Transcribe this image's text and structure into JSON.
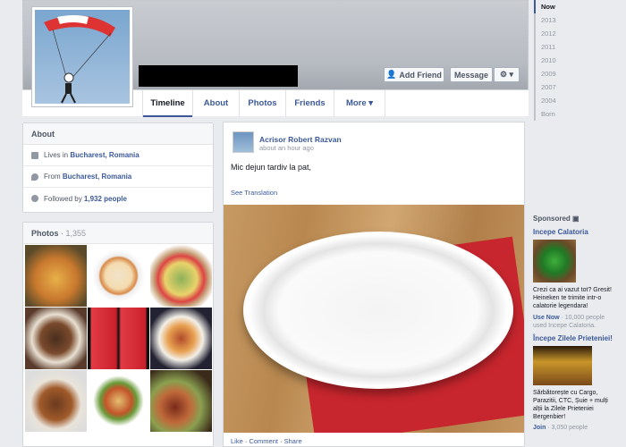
{
  "profile": {
    "buttons": {
      "add_friend": "Add Friend",
      "message": "Message",
      "settings": "⚙ ▾"
    },
    "tabs": [
      "Timeline",
      "About",
      "Photos",
      "Friends",
      "More ▾"
    ]
  },
  "timeline_years": [
    "Now",
    "2013",
    "2012",
    "2011",
    "2010",
    "2009",
    "2007",
    "2004",
    "Born"
  ],
  "about": {
    "title": "About",
    "lives_prefix": "Lives in ",
    "lives_place": "Bucharest, Romania",
    "from_prefix": "From ",
    "from_place": "Bucharest, Romania",
    "followed_prefix": "Followed by ",
    "followed_count": "1,932 people"
  },
  "photos_box": {
    "title": "Photos",
    "count": " · 1,355"
  },
  "post": {
    "author": "Acrisor Robert Razvan",
    "time": "about an hour ago",
    "text": "Mic dejun tardiv la pat,",
    "see_translation": "See Translation",
    "actions": {
      "like": "Like",
      "comment": "Comment",
      "share": "Share"
    }
  },
  "sponsored": {
    "title": "Sponsored",
    "ads": [
      {
        "title": "Incepe Calatoria",
        "body": "Crezi ca ai vazut tot? Gresit! Heineken te trimite intr-o calatorie legendara!",
        "cta": "Use Now",
        "social": " · 10,000 people used Incepe Calatoria."
      },
      {
        "title": "Începe Zilele Prieteniei!",
        "body": "Sărbătorește cu Cargo, Parazitii, CTC, Șuie + mulți alții la Zilele Prieteniei Bergenbier!",
        "cta": "Join",
        "social": " · 3,050 people"
      }
    ]
  }
}
